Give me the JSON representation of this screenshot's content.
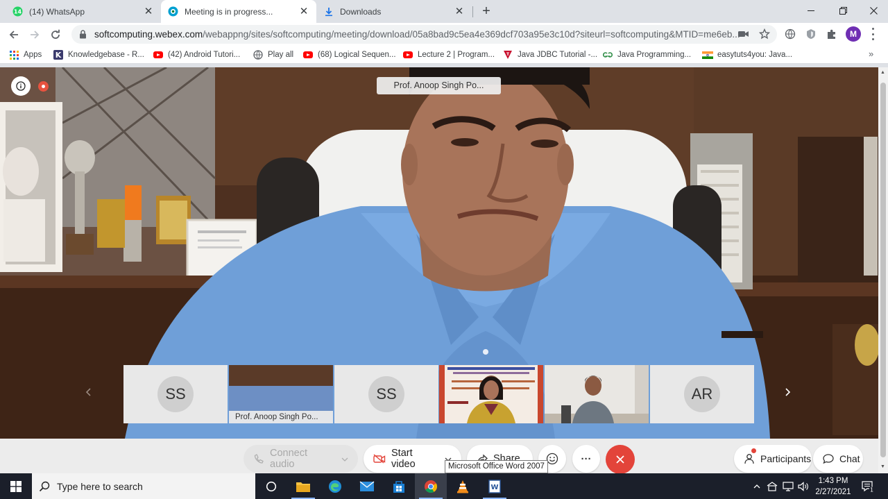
{
  "browser": {
    "tabs": [
      {
        "title": "(14) WhatsApp",
        "favicon": "whatsapp-icon",
        "active": false
      },
      {
        "title": "Meeting is in progress...",
        "favicon": "webex-icon",
        "active": true
      },
      {
        "title": "Downloads",
        "favicon": "download-icon",
        "active": false
      }
    ],
    "new_tab_label": "+",
    "address": {
      "host": "softcomputing.webex.com",
      "path": "/webappng/sites/softcomputing/meeting/download/05a8bad9c5ea4e369dcf703a95e3c10d?siteurl=softcomputing&MTID=me6eb..."
    },
    "profile_initial": "M",
    "bookmarks": [
      {
        "label": "Apps",
        "icon": "apps-grid-icon"
      },
      {
        "label": "Knowledgebase - R...",
        "icon": "k-icon"
      },
      {
        "label": "(42) Android Tutori...",
        "icon": "youtube-icon"
      },
      {
        "label": "Play all",
        "icon": "globe-icon"
      },
      {
        "label": "(68) Logical Sequen...",
        "icon": "youtube-icon"
      },
      {
        "label": "Lecture 2 | Program...",
        "icon": "youtube-icon"
      },
      {
        "label": "Java JDBC Tutorial -...",
        "icon": "javatpoint-icon"
      },
      {
        "label": "Java Programming...",
        "icon": "gfg-icon"
      },
      {
        "label": "easytuts4you: Java...",
        "icon": "flag-india-icon"
      }
    ],
    "bookmarks_more": "»"
  },
  "meeting": {
    "active_speaker_label": "Prof. Anoop Singh Po...",
    "filmstrip": [
      {
        "type": "initials",
        "initials": "SS"
      },
      {
        "type": "video",
        "label": "Prof. Anoop Singh Po..."
      },
      {
        "type": "initials",
        "initials": "SS"
      },
      {
        "type": "video",
        "label": ""
      },
      {
        "type": "video",
        "label": ""
      },
      {
        "type": "initials",
        "initials": "AR"
      }
    ],
    "controls": {
      "connect_audio": "Connect audio",
      "start_video": "Start video",
      "share": "Share",
      "more": "···",
      "participants": "Participants",
      "chat": "Chat"
    },
    "tooltip": "Microsoft Office Word 2007",
    "colors": {
      "end_call": "#e3443a",
      "notification": "#e3443a"
    }
  },
  "taskbar": {
    "search_placeholder": "Type here to search",
    "time": "1:43 PM",
    "date": "2/27/2021",
    "notification_count": "1"
  }
}
